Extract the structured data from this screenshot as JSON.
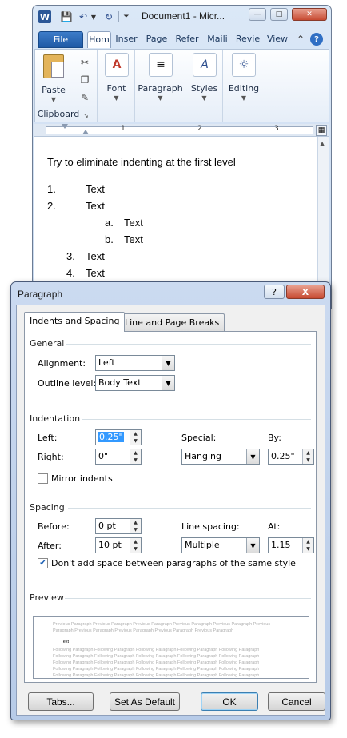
{
  "word": {
    "title": "Document1 - Micr...",
    "tabs": [
      "File",
      "Hom",
      "Inser",
      "Page",
      "Refer",
      "Maili",
      "Revie",
      "View"
    ],
    "groups": {
      "paste": "Paste",
      "clipboard": "Clipboard",
      "font": "Font",
      "paragraph": "Paragraph",
      "styles": "Styles",
      "editing": "Editing"
    },
    "ruler_numbers": [
      "1",
      "2",
      "3"
    ],
    "document": {
      "heading": "Try to eliminate indenting at the first level",
      "lines": [
        {
          "marker": "1.",
          "text": "Text"
        },
        {
          "marker": "2.",
          "text": "Text"
        },
        {
          "marker": "a.",
          "text": "Text"
        },
        {
          "marker": "b.",
          "text": "Text"
        },
        {
          "marker": "3.",
          "text": "Text"
        },
        {
          "marker": "4.",
          "text": "Text"
        }
      ]
    }
  },
  "dialog": {
    "title": "Paragraph",
    "help": "?",
    "close": "X",
    "tabs": {
      "indents": "Indents and Spacing",
      "breaks": "Line and Page Breaks"
    },
    "general": {
      "heading": "General",
      "alignment_label": "Alignment:",
      "alignment_value": "Left",
      "outline_label": "Outline level:",
      "outline_value": "Body Text"
    },
    "indentation": {
      "heading": "Indentation",
      "left_label": "Left:",
      "left_value": "0.25\"",
      "right_label": "Right:",
      "right_value": "0\"",
      "special_label": "Special:",
      "special_value": "Hanging",
      "by_label": "By:",
      "by_value": "0.25\"",
      "mirror_label": "Mirror indents",
      "mirror_checked": false
    },
    "spacing": {
      "heading": "Spacing",
      "before_label": "Before:",
      "before_value": "0 pt",
      "after_label": "After:",
      "after_value": "10 pt",
      "line_spacing_label": "Line spacing:",
      "line_spacing_value": "Multiple",
      "at_label": "At:",
      "at_value": "1.15",
      "dont_add_label": "Don't add space between paragraphs of the same style",
      "dont_add_checked": true
    },
    "preview": {
      "heading": "Preview",
      "previous": "Previous Paragraph Previous Paragraph Previous Paragraph Previous Paragraph Previous Paragraph Previous",
      "previous2": "Paragraph Previous Paragraph Previous Paragraph Previous Paragraph Previous Paragraph",
      "sample": "Text",
      "following": "Following Paragraph Following Paragraph Following Paragraph Following Paragraph Following Paragraph"
    },
    "buttons": {
      "tabs": "Tabs...",
      "set_default": "Set As Default",
      "ok": "OK",
      "cancel": "Cancel"
    }
  }
}
